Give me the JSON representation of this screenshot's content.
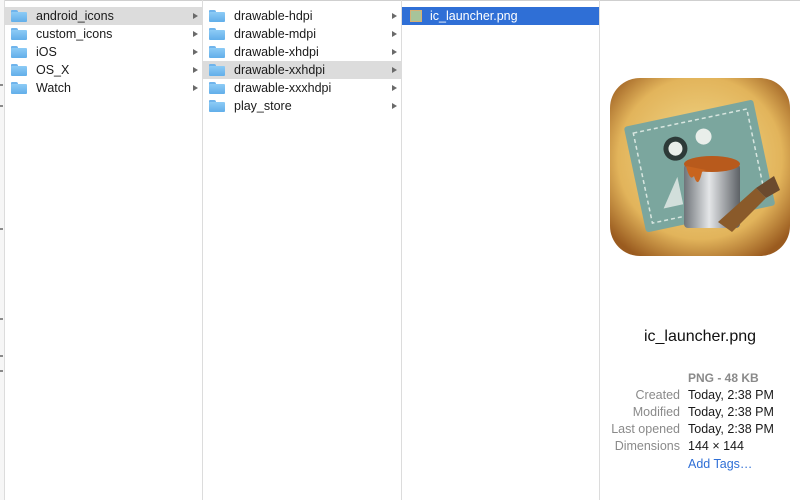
{
  "columns": [
    {
      "items": [
        {
          "label": "android_icons",
          "selected": true
        },
        {
          "label": "custom_icons"
        },
        {
          "label": "iOS"
        },
        {
          "label": "OS_X"
        },
        {
          "label": "Watch"
        }
      ]
    },
    {
      "items": [
        {
          "label": "drawable-hdpi"
        },
        {
          "label": "drawable-mdpi"
        },
        {
          "label": "drawable-xhdpi"
        },
        {
          "label": "drawable-xxhdpi",
          "selected": true
        },
        {
          "label": "drawable-xxxhdpi"
        },
        {
          "label": "play_store"
        }
      ]
    },
    {
      "items": [
        {
          "label": "ic_launcher.png",
          "active": true
        }
      ]
    }
  ],
  "preview": {
    "file_name": "ic_launcher.png",
    "kind": "PNG - 48 KB",
    "rows": [
      {
        "key": "Created",
        "value": "Today, 2:38 PM"
      },
      {
        "key": "Modified",
        "value": "Today, 2:38 PM"
      },
      {
        "key": "Last opened",
        "value": "Today, 2:38 PM"
      },
      {
        "key": "Dimensions",
        "value": "144 × 144"
      }
    ],
    "add_tags": "Add Tags…"
  },
  "colors": {
    "selection_active": "#2f6fd6",
    "selection_inactive": "#dcdcdc",
    "folder": "#6fb4ec",
    "link": "#2f6fd6"
  }
}
